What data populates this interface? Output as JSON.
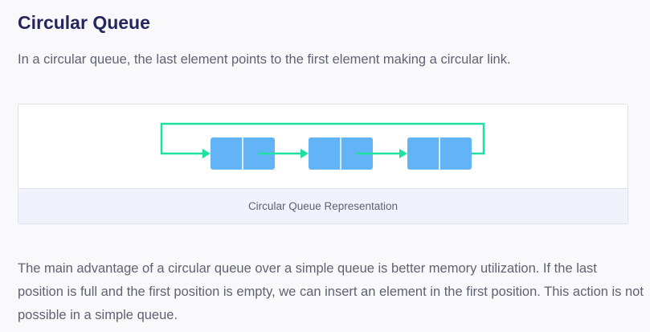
{
  "heading": "Circular Queue",
  "intro": "In a circular queue, the last element points to the first element making a circular link.",
  "figure": {
    "caption": "Circular Queue Representation",
    "node_count": 3,
    "colors": {
      "node_fill": "#62b4f7",
      "node_divider": "#ffffff",
      "link_arrow": "#1ee0a0"
    },
    "icons": [
      "queue-node",
      "link-arrow",
      "circular-return-arrow"
    ]
  },
  "paragraph": "The main advantage of a circular queue over a simple queue is better memory utilization. If the last position is full and the first position is empty, we can insert an element in the first position. This action is not possible in a simple queue."
}
